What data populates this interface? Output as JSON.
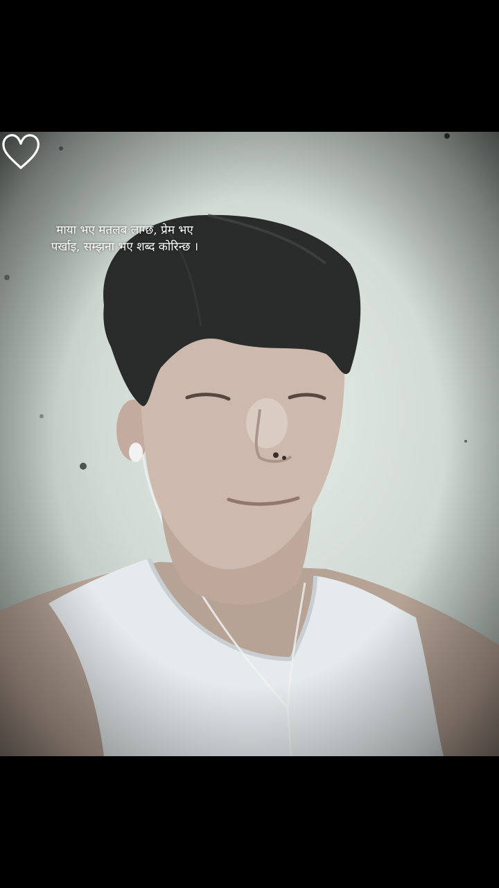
{
  "caption": {
    "line1": "माया भए मतलब लाग्छ, प्रेम भए",
    "line2": "पर्खाइ, सम्झना भए शब्द कोरिन्छ ।"
  },
  "decorations": {
    "heart_icon": "heart-outline-icon",
    "heart_color": "#ffffff"
  },
  "colors": {
    "background": "#000000",
    "wall": "#dfe6e2",
    "hair": "#1b1d1d",
    "skin": "#c9b3a6",
    "shirt": "#e7ecef"
  }
}
